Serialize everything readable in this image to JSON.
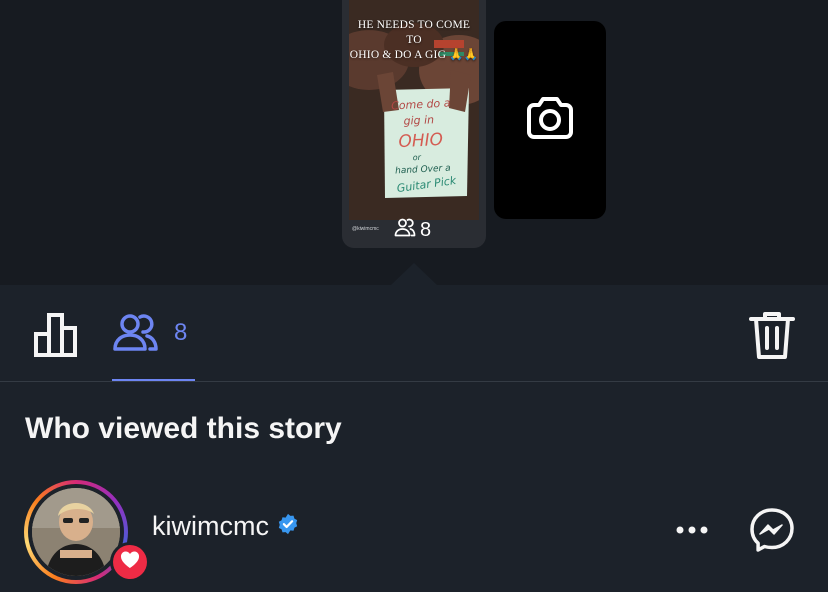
{
  "story": {
    "caption": "HE NEEDS TO COME TO\nOHIO & DO A GIG 🙏🙏",
    "sign_lines": [
      "Come do a",
      "gig in",
      "OHIO",
      "or",
      "hand Over a",
      "Guitar Pick"
    ],
    "footer_handle": "@kiwimcmc",
    "viewer_count": "8"
  },
  "tabs": {
    "viewers_count": "8"
  },
  "viewers_section": {
    "title": "Who viewed this story",
    "viewers": [
      {
        "username": "kiwimcmc",
        "verified": true,
        "liked": true
      }
    ]
  },
  "icons": {
    "camera": "camera-icon",
    "stats": "bar-chart-icon",
    "viewers": "people-icon",
    "delete": "trash-icon",
    "more": "more-horizontal-icon",
    "messenger": "messenger-icon",
    "verified": "verified-badge-icon",
    "like": "heart-icon"
  },
  "colors": {
    "accent": "#6d85f2",
    "verified": "#3897f0",
    "like": "#ee2b45",
    "background": "#1c222a"
  }
}
